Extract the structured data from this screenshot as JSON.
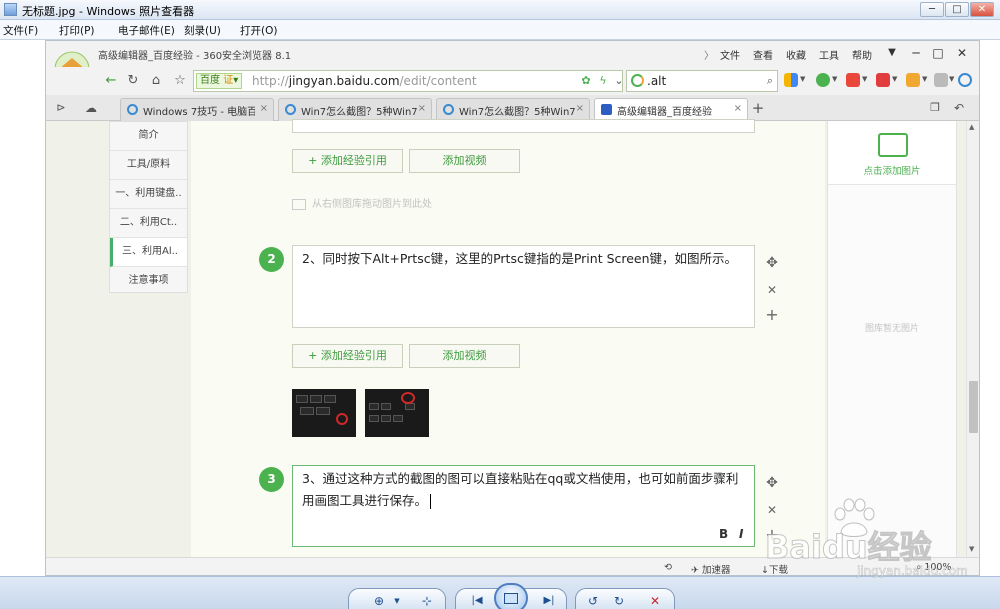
{
  "viewer": {
    "title": "无标题.jpg - Windows 照片查看器",
    "menu": [
      {
        "id": "file",
        "label": "文件(F)"
      },
      {
        "id": "print",
        "label": "打印(P)"
      },
      {
        "id": "email",
        "label": "电子邮件(E)"
      },
      {
        "id": "burn",
        "label": "刻录(U)"
      },
      {
        "id": "open",
        "label": "打开(O)"
      }
    ],
    "window_controls": [
      "─",
      "□",
      "✕"
    ]
  },
  "browser": {
    "title": "高级编辑器_百度经验 - 360安全浏览器 8.1",
    "menu": [
      "文件",
      "查看",
      "收藏",
      "工具",
      "帮助"
    ],
    "menu_chevron": "〉",
    "address": {
      "badge": "百度",
      "badge_extra": "证",
      "url_prefix": "http://",
      "url_host": "jingyan.baidu.com",
      "url_path": "/edit/content"
    },
    "search": {
      "value": ".alt"
    },
    "tabs": [
      {
        "label": "Windows 7技巧 - 电脑百科",
        "active": false
      },
      {
        "label": "Win7怎么截图？5种Win7截",
        "active": false
      },
      {
        "label": "Win7怎么截图？5种Win7截",
        "active": false
      },
      {
        "label": "高级编辑器_百度经验",
        "active": true
      }
    ],
    "tab_close": "×",
    "new_tab": "+"
  },
  "left_nav": [
    {
      "label": "简介",
      "active": false
    },
    {
      "label": "工具/原料",
      "active": false
    },
    {
      "label": "一、利用键盘..",
      "active": false
    },
    {
      "label": "二、利用Ct..",
      "active": false
    },
    {
      "label": "三、利用Al..",
      "active": true
    },
    {
      "label": "注意事项",
      "active": false
    }
  ],
  "editor": {
    "add_ref_label": "+ 添加经验引用",
    "add_video_label": "添加视频",
    "drag_hint": "从右侧图库拖动图片到此处",
    "steps": [
      {
        "number": "2",
        "text": "2、同时按下Alt+Prtsc键，这里的Prtsc键指的是Print Screen键，如图所示。"
      },
      {
        "number": "3",
        "text": "3、通过这种方式的截图的图可以直接粘贴在qq或文档使用，也可如前面步骤利用画图工具进行保存。"
      }
    ],
    "tools": {
      "move": "✥",
      "delete": "✕",
      "add": "+"
    },
    "format": {
      "bold": "B",
      "italic": "I"
    }
  },
  "right_panel": {
    "add_image_label": "点击添加图片",
    "empty_text": "图库暂无图片"
  },
  "statusbar": {
    "accelerator": "加速器",
    "download": "下载",
    "zoom": "100%"
  },
  "watermark": {
    "brand": "Baidu经验",
    "url": "jingyan.baidu.com"
  },
  "colors": {
    "accent_green": "#4bb24f",
    "link_green": "#3d9a3d",
    "viewer_blue": "#1e4f8f"
  }
}
